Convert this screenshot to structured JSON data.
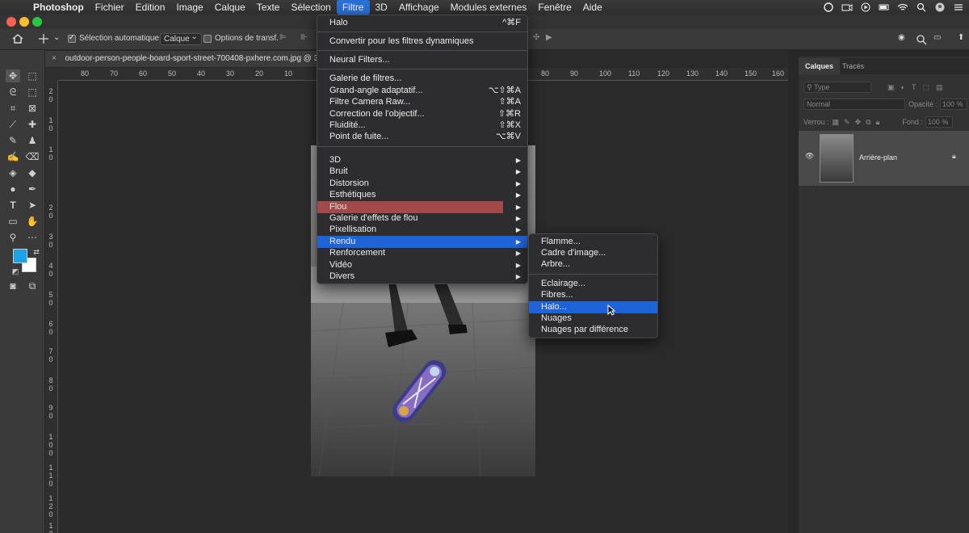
{
  "menubar": {
    "app_name": "Photoshop",
    "items": [
      "Fichier",
      "Edition",
      "Image",
      "Calque",
      "Texte",
      "Sélection",
      "Filtre",
      "3D",
      "Affichage",
      "Modules externes",
      "Fenêtre",
      "Aide"
    ],
    "active": "Filtre"
  },
  "options_bar": {
    "auto_select_label": "Sélection automatique :",
    "auto_select_value": "Calque",
    "transform_label": "Options de transf."
  },
  "document": {
    "tab_title": "outdoor-person-people-board-sport-street-700408-pxhere.com.jpg @ 3"
  },
  "rulers": {
    "horizontal": [
      "80",
      "70",
      "60",
      "50",
      "40",
      "30",
      "20",
      "10",
      "80",
      "90",
      "100",
      "110",
      "120",
      "130",
      "140",
      "150",
      "160"
    ],
    "vertical": [
      "2 0",
      "1 0",
      "1 0",
      "2 0",
      "3 0",
      "4 0",
      "5 0",
      "6 0",
      "7 0",
      "8 0",
      "9 0",
      "1 0 0",
      "1 1 0",
      "1 2 0",
      "1 3"
    ]
  },
  "filter_menu": {
    "last_filter": {
      "label": "Halo",
      "shortcut": "^⌘F"
    },
    "convert_label": "Convertir pour les filtres dynamiques",
    "neural_label": "Neural Filters...",
    "group1": [
      {
        "label": "Galerie de filtres...",
        "shortcut": ""
      },
      {
        "label": "Grand-angle adaptatif...",
        "shortcut": "⌥⇧⌘A"
      },
      {
        "label": "Filtre Camera Raw...",
        "shortcut": "⇧⌘A"
      },
      {
        "label": "Correction de l'objectif...",
        "shortcut": "⇧⌘R"
      },
      {
        "label": "Fluidité...",
        "shortcut": "⇧⌘X"
      },
      {
        "label": "Point de fuite...",
        "shortcut": "⌥⌘V"
      }
    ],
    "submenus": [
      "3D",
      "Bruit",
      "Distorsion",
      "Esthétiques",
      "Flou",
      "Galerie d'effets de flou",
      "Pixellisation",
      "Rendu",
      "Renforcement",
      "Vidéo",
      "Divers"
    ],
    "highlighted": "Rendu",
    "hovered": "Flou"
  },
  "rendu_menu": {
    "group1": [
      "Flamme...",
      "Cadre d'image...",
      "Arbre..."
    ],
    "group2": [
      "Eclairage...",
      "Fibres...",
      "Halo...",
      "Nuages",
      "Nuages par différence"
    ],
    "highlighted": "Halo..."
  },
  "layers_panel": {
    "tabs": [
      "Calques",
      "Tracés"
    ],
    "active_tab": "Calques",
    "filter_placeholder": "Type",
    "blend_mode": "Normal",
    "opacity_label": "Opacité :",
    "opacity_value": "100 %",
    "lock_label": "Verrou :",
    "fill_label": "Fond :",
    "fill_value": "100 %",
    "layer_name": "Arrière-plan"
  },
  "colors": {
    "accent": "#1f63d8",
    "foreground_color": "#1aa3e8",
    "background_color": "#ffffff"
  },
  "icons": [
    "apple-icon",
    "home-icon",
    "move-tool-icon",
    "marquee-icon",
    "lasso-icon",
    "crop-icon",
    "eyedropper-icon",
    "brush-icon",
    "stamp-icon",
    "eraser-icon",
    "paint-bucket-icon",
    "pen-icon",
    "text-icon",
    "hand-icon",
    "zoom-icon",
    "eye-icon",
    "lock-icon",
    "search-icon",
    "wifi-icon"
  ]
}
